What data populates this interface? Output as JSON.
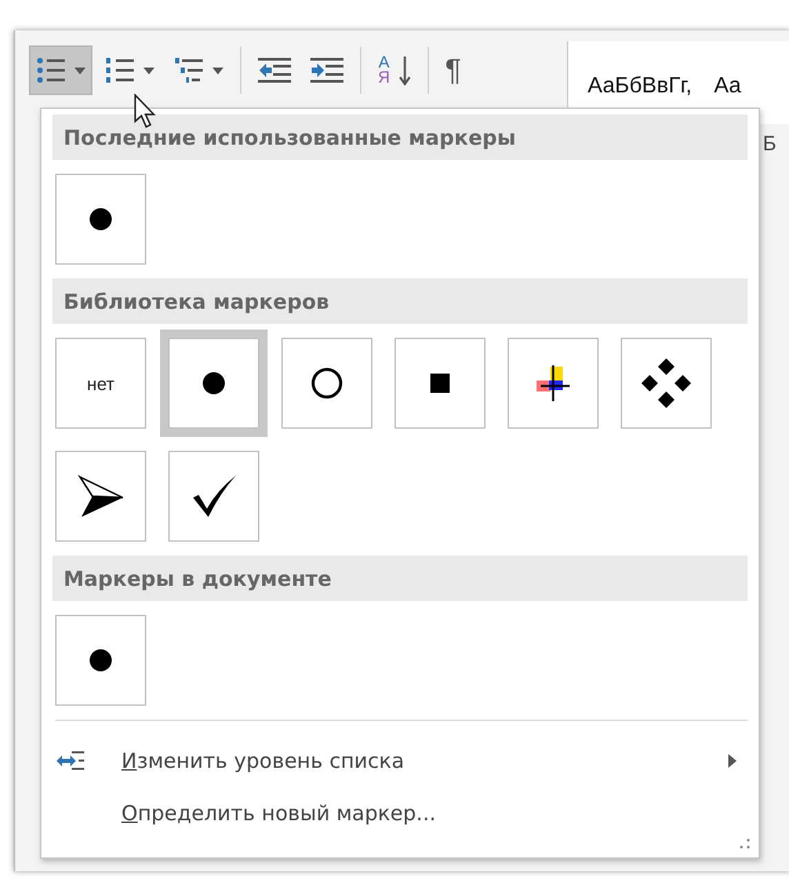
{
  "toolbar": {
    "buttons": [
      {
        "kind": "bullets",
        "selected": true,
        "dropdown": true
      },
      {
        "kind": "numbering",
        "selected": false,
        "dropdown": true
      },
      {
        "kind": "multilevel",
        "selected": false,
        "dropdown": true
      },
      {
        "kind": "decrease-indent",
        "selected": false,
        "dropdown": false
      },
      {
        "kind": "increase-indent",
        "selected": false,
        "dropdown": false
      },
      {
        "kind": "sort",
        "selected": false,
        "dropdown": false,
        "letters": [
          "А",
          "Я"
        ]
      },
      {
        "kind": "pilcrow",
        "selected": false,
        "dropdown": false,
        "text": "¶"
      }
    ],
    "styles": [
      "АаБбВвГг,",
      "Аа"
    ],
    "behind_text": "Б"
  },
  "menu": {
    "sections": [
      {
        "title": "Последние использованные маркеры",
        "markers": [
          {
            "kind": "dot",
            "selected": false
          }
        ]
      },
      {
        "title": "Библиотека маркеров",
        "markers": [
          {
            "kind": "none",
            "text": "нет",
            "selected": false
          },
          {
            "kind": "dot",
            "selected": true
          },
          {
            "kind": "circle",
            "selected": false
          },
          {
            "kind": "square",
            "selected": false
          },
          {
            "kind": "color-cross",
            "selected": false
          },
          {
            "kind": "diamonds",
            "selected": false
          },
          {
            "kind": "arrow",
            "selected": false
          },
          {
            "kind": "check",
            "selected": false
          }
        ]
      },
      {
        "title": "Маркеры в документе",
        "markers": [
          {
            "kind": "dot",
            "selected": false
          }
        ]
      }
    ],
    "items": [
      {
        "kind": "level",
        "access_key": "И",
        "label": "зменить уровень списка",
        "submenu": true
      },
      {
        "kind": "define",
        "access_key": "О",
        "label": "пределить новый маркер...",
        "submenu": false
      }
    ]
  }
}
